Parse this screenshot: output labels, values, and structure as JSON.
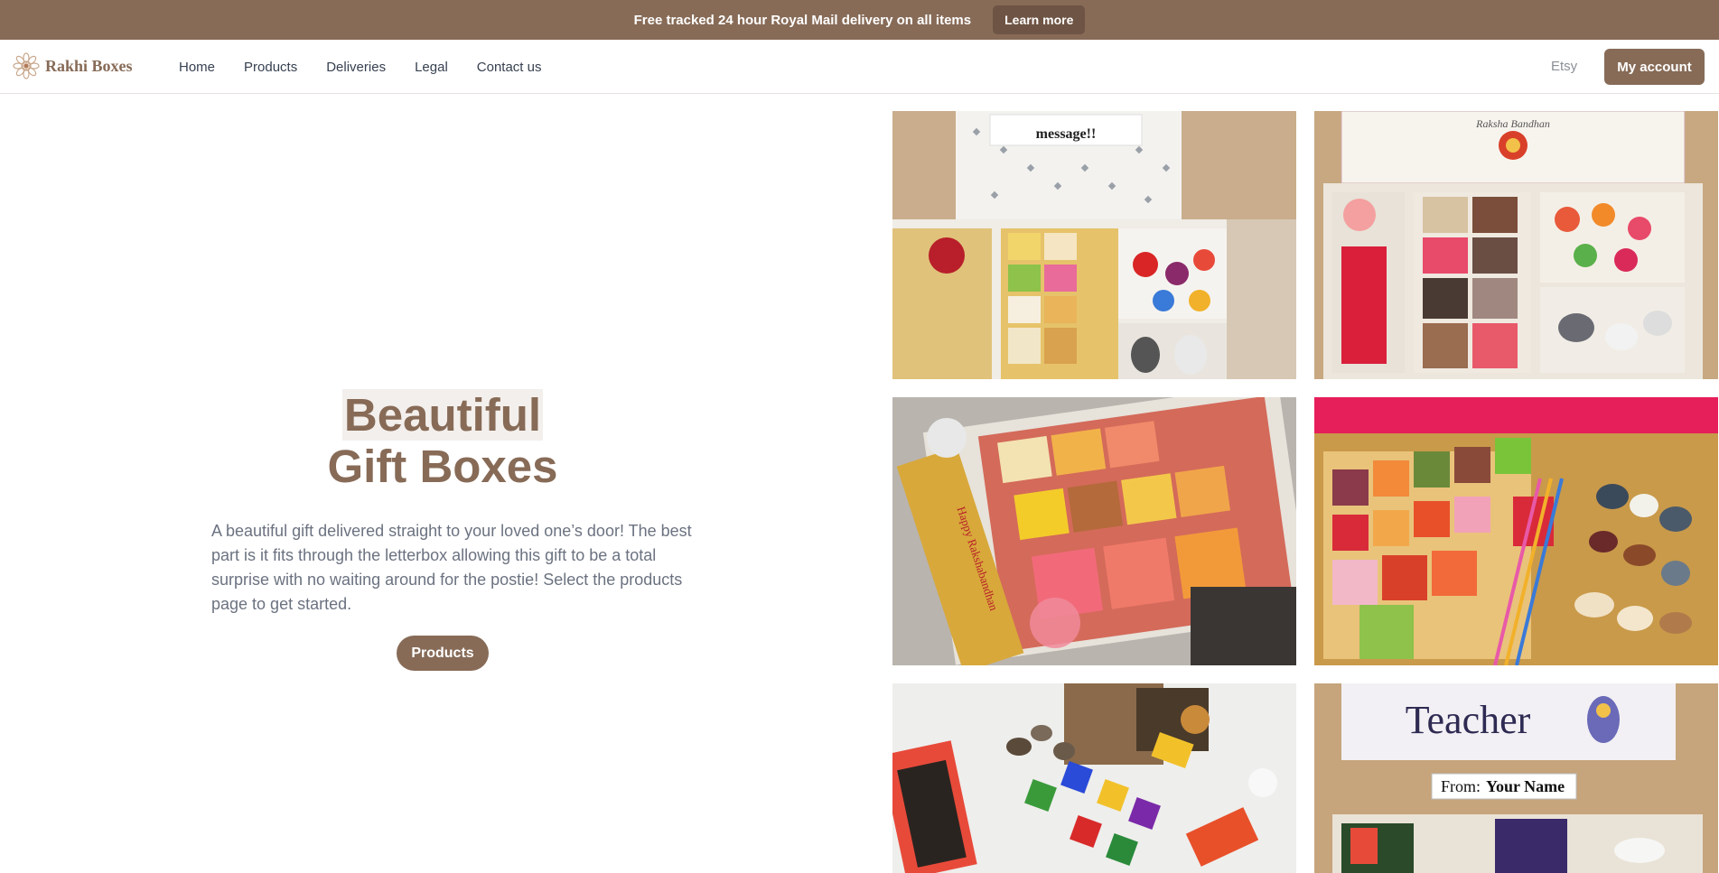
{
  "announcement": {
    "text": "Free tracked 24 hour Royal Mail delivery on all items",
    "button": "Learn more"
  },
  "brand": {
    "name": "Rakhi Boxes",
    "logo_icon": "rakhi-flower-icon",
    "accent": "#876b57"
  },
  "nav": {
    "items": [
      {
        "label": "Home"
      },
      {
        "label": "Products"
      },
      {
        "label": "Deliveries"
      },
      {
        "label": "Legal"
      },
      {
        "label": "Contact us"
      }
    ],
    "etsy": "Etsy",
    "account": "My account"
  },
  "hero": {
    "title_line1": "Beautiful",
    "title_line2": "Gift Boxes",
    "description": "A beautiful gift delivered straight to your loved one’s door! The best part is it fits through the letterbox allowing this gift to be a total surprise with no waiting around for the postie! Select the products page to get started.",
    "button": "Products"
  },
  "gallery": {
    "tiles": [
      {
        "sign": "message!!"
      },
      {
        "sign": "Raksha Bandhan"
      },
      {
        "sign": "Happy Rakshabandhan"
      },
      {
        "sign": ""
      },
      {
        "sign": ""
      },
      {
        "sign": "Teacher",
        "sign2": "From:",
        "sign3": "Your Name"
      }
    ]
  }
}
